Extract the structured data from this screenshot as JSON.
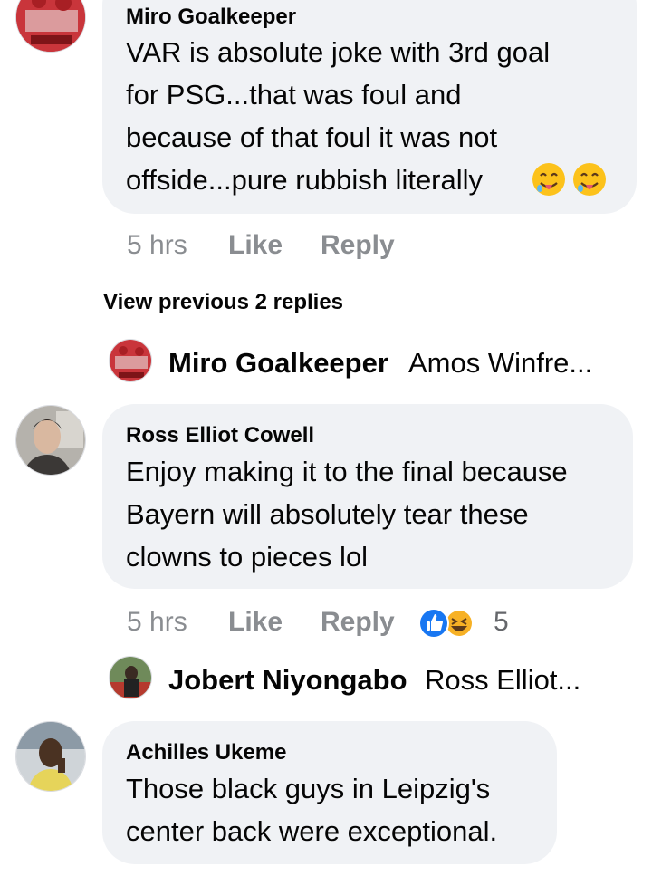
{
  "comments": [
    {
      "author": "Miro Goalkeeper",
      "text": "VAR is absolute joke with 3rd goal\nfor PSG...that was foul and\nbecause of that foul it was not\noffside...pure rubbish literally",
      "emoji": [
        "drooling-face",
        "drooling-face"
      ],
      "time": "5 hrs",
      "like_label": "Like",
      "reply_label": "Reply",
      "view_previous": "View previous 2 replies",
      "latest_reply": {
        "author": "Miro Goalkeeper",
        "preview": "Amos Winfre..."
      },
      "avatar_color": "#c0282e"
    },
    {
      "author": "Ross Elliot Cowell",
      "text": "Enjoy making it to the final because\nBayern will absolutely tear these\nclowns to pieces lol",
      "time": "5 hrs",
      "like_label": "Like",
      "reply_label": "Reply",
      "reactions": {
        "types": [
          "like",
          "haha"
        ],
        "count": "5"
      },
      "latest_reply": {
        "author": "Jobert Niyongabo",
        "preview": "Ross Elliot..."
      },
      "avatar_color": "#6d6a64"
    },
    {
      "author": "Achilles Ukeme",
      "text": "Those black guys in Leipzig's\ncenter back were exceptional.",
      "avatar_color": "#8c7f64"
    }
  ],
  "colors": {
    "bubble": "#f0f2f5",
    "meta_text": "#8a8d91",
    "like_blue": "#1877f2",
    "haha_yellow": "#f7b125"
  }
}
